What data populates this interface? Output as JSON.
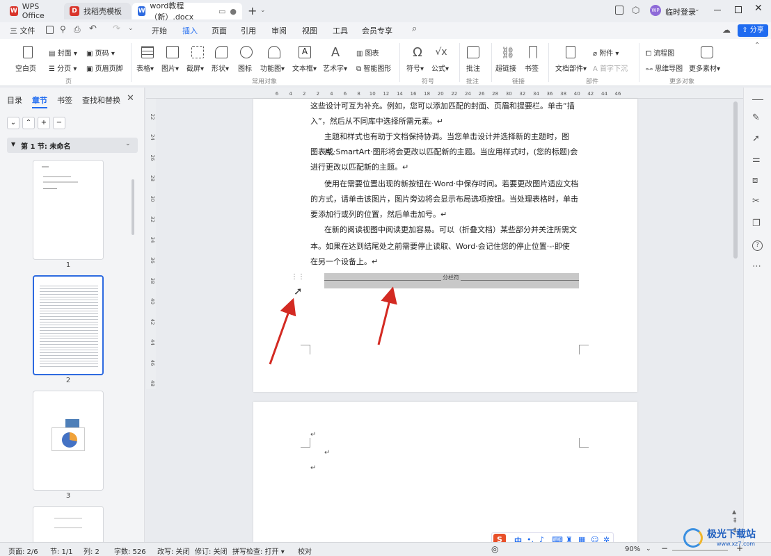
{
  "titlebar": {
    "tabs": [
      {
        "label": "WPS Office"
      },
      {
        "label": "找稻壳模板"
      },
      {
        "label": "word教程（新）.docx"
      }
    ],
    "login_label": "临时登录",
    "avatar_text": "WP"
  },
  "menubar": {
    "file_label": "三 文件",
    "tabs": [
      "开始",
      "插入",
      "页面",
      "引用",
      "审阅",
      "视图",
      "工具",
      "会员专享"
    ],
    "active_tab": "插入",
    "share_label": "分享"
  },
  "ribbon": {
    "page_group": {
      "cover": "封面",
      "blank_page": "空白页",
      "page_break": "分页",
      "page_number": "页码",
      "header_footer": "页眉页脚",
      "label": "页"
    },
    "common_group": {
      "table": "表格",
      "picture": "图片",
      "screenshot": "截屏",
      "shape": "形状",
      "icon": "图标",
      "smart_chart": "功能图",
      "textbox": "文本框",
      "wordart": "艺术字",
      "chart": "图表",
      "smart_shape": "智能图形",
      "label": "常用对象"
    },
    "symbol_group": {
      "symbol": "符号",
      "formula": "公式",
      "label": "符号"
    },
    "comment_group": {
      "comment": "批注",
      "label": "批注"
    },
    "link_group": {
      "hyperlink": "超链接",
      "bookmark": "书签",
      "label": "链接"
    },
    "parts_group": {
      "doc_parts": "文档部件",
      "attachment": "附件",
      "dropcap": "首字下沉",
      "label": "部件"
    },
    "more_group": {
      "flowchart": "流程图",
      "mindmap": "思维导图",
      "more": "更多素材",
      "label": "更多对象"
    }
  },
  "leftpanel": {
    "tabs": [
      "目录",
      "章节",
      "书签",
      "查找和替换"
    ],
    "active_tab": "章节",
    "section_title": "第 1 节: 未命名",
    "pages": [
      "1",
      "2",
      "3"
    ]
  },
  "rulers": {
    "h_ticks": [
      "6",
      "4",
      "2",
      "2",
      "4",
      "6",
      "8",
      "10",
      "12",
      "14",
      "16",
      "18",
      "20",
      "22",
      "24",
      "26",
      "28",
      "30",
      "32",
      "34",
      "36",
      "38",
      "40",
      "42",
      "44",
      "46"
    ],
    "v_ticks": [
      "22",
      "24",
      "26",
      "28",
      "30",
      "32",
      "34",
      "36",
      "38",
      "40",
      "42",
      "44",
      "46",
      "48"
    ]
  },
  "document": {
    "paragraphs": [
      "这些设计可互为补充。例如，您可以添加匹配的封面、页眉和提要栏。单击“插",
      "入”，然后从不同库中选择所需元素。↵",
      "主题和样式也有助于文档保持协调。当您单击设计并选择新的主题时，图片、",
      "图表或·SmartArt·图形将会更改以匹配新的主题。当应用样式时，(您的标题)会",
      "进行更改以匹配新的主题。↵",
      "使用在需要位置出现的新按钮在·Word·中保存时间。若要更改图片适应文档",
      "的方式，请单击该图片，图片旁边将会显示布局选项按钮。当处理表格时，单击",
      "要添加行或列的位置，然后单击加号。↵",
      "在新的阅读视图中阅读更加容易。可以（折叠文档）某些部分并关注所需文",
      "本。如果在达到结尾处之前需要停止读取、Word·会记住您的停止位置·-·即使",
      "在另一个设备上。↵"
    ],
    "section_break_label": "分栏符",
    "page2_marks": [
      "↵",
      "↵",
      "↵"
    ]
  },
  "statusbar": {
    "page": "页面: 2/6",
    "section": "节: 1/1",
    "column": "列: 2",
    "words": "字数: 526",
    "revise": "改写: 关闭",
    "track": "修订: 关闭",
    "spellcheck": "拼写检查: 打开",
    "proofread": "校对",
    "zoom": "90%"
  },
  "ime": {
    "label": "中"
  },
  "watermark": {
    "text": "极光下载站",
    "url": "www.xz7.com"
  },
  "colors": {
    "accent": "#1f6bf0",
    "wps_red": "#d9352b",
    "arrow": "#d32a22"
  }
}
